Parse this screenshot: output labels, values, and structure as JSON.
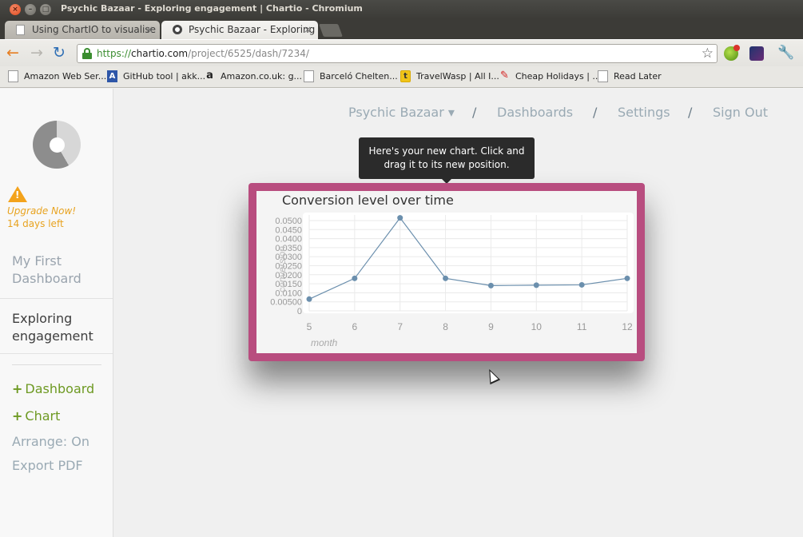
{
  "window": {
    "title": "Psychic Bazaar - Exploring engagement | Chartio - Chromium",
    "close_glyph": "×",
    "min_glyph": "–",
    "max_glyph": "□"
  },
  "tabs": [
    {
      "label": "Using ChartIO to visualise",
      "icon": "document-icon",
      "close": "×"
    },
    {
      "label": "Psychic Bazaar - Exploring",
      "icon": "chartio-icon",
      "close": "×"
    }
  ],
  "toolbar": {
    "back_glyph": "←",
    "forward_glyph": "→",
    "reload_glyph": "↻",
    "url_scheme": "https://",
    "url_host": "chartio.com",
    "url_path": "/project/6525/dash/7234/",
    "star_glyph": "☆",
    "wrench_glyph": "🔧"
  },
  "bookmarks": [
    {
      "label": "Amazon Web Ser...",
      "icon": "document-icon"
    },
    {
      "label": "GitHub tool | akk...",
      "icon": "github-icon",
      "glyph": "A"
    },
    {
      "label": "Amazon.co.uk: g...",
      "icon": "amazon-icon",
      "glyph": "a"
    },
    {
      "label": "Barceló Chelten...",
      "icon": "document-icon"
    },
    {
      "label": "TravelWasp | All I...",
      "icon": "travelwasp-icon",
      "glyph": "t"
    },
    {
      "label": "Cheap Holidays | ...",
      "icon": "pin-icon",
      "glyph": "✎"
    },
    {
      "label": "Read Later",
      "icon": "document-icon"
    }
  ],
  "sidebar": {
    "upgrade": "Upgrade Now!",
    "days_left": "14 days left",
    "warn_glyph": "!",
    "dashboards": [
      {
        "label": "My First Dashboard"
      },
      {
        "label": "Exploring engagement"
      }
    ],
    "actions": {
      "plus": "+",
      "add_dashboard": "Dashboard",
      "add_chart": "Chart",
      "arrange": "Arrange: On",
      "export": "Export PDF"
    }
  },
  "topnav": {
    "project": "Psychic Bazaar ▾",
    "separator": "/",
    "dashboards": "Dashboards",
    "settings": "Settings",
    "sign_out": "Sign Out"
  },
  "tooltip": {
    "text": "Here's your new chart. Click and drag it to its new position."
  },
  "chart_data": {
    "type": "line",
    "title": "Conversion level over time",
    "xlabel": "month",
    "ylabel": "conversion",
    "x": [
      5,
      6,
      7,
      8,
      9,
      10,
      11,
      12
    ],
    "series": [
      {
        "values": [
          0.0065,
          0.018,
          0.0515,
          0.018,
          0.014,
          0.0142,
          0.0144,
          0.018
        ]
      }
    ],
    "yticks": [
      "0.0500",
      "0.0450",
      "0.0400",
      "0.0350",
      "0.0300",
      "0.0250",
      "0.0200",
      "0.0150",
      "0.0100",
      "0.00500",
      "0"
    ],
    "ylim": [
      0,
      0.05
    ],
    "grid": true,
    "line_color": "#6b8fad"
  }
}
